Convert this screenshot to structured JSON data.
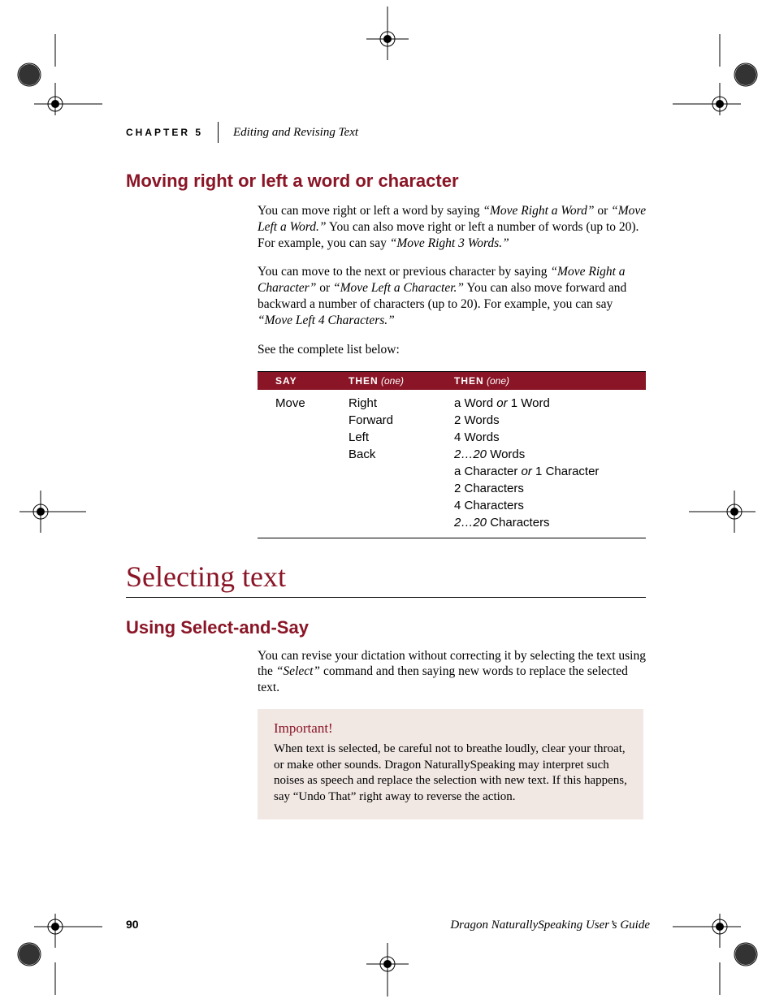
{
  "header": {
    "chapter_label": "CHAPTER 5",
    "chapter_title": "Editing and Revising Text"
  },
  "section1": {
    "heading": "Moving right or left a word or character",
    "para1_a": "You can move right or left a word by saying ",
    "para1_q1": "“Move Right a Word”",
    "para1_b": " or ",
    "para1_q2": "“Move Left a Word.”",
    "para1_c": " You can also move right or left a number of words (up to 20). For example, you can say ",
    "para1_q3": "“Move Right 3 Words.”",
    "para2_a": "You can move to the next or previous character by saying ",
    "para2_q1": "“Move Right a Character”",
    "para2_b": " or ",
    "para2_q2": "“Move Left a Character.”",
    "para2_c": " You can also move forward and backward a number of characters (up to 20). For example, you can say ",
    "para2_q3": "“Move Left 4 Characters.”",
    "para3": "See the complete list below:"
  },
  "table": {
    "head": {
      "say": "SAY",
      "then_label": "THEN",
      "then_note": "(one)"
    },
    "rows": [
      {
        "say": "Move",
        "then1": "Right",
        "then2_a": "a Word ",
        "then2_or": "or",
        "then2_b": " 1 Word"
      },
      {
        "say": "",
        "then1": "Forward",
        "then2_a": "2 Words",
        "then2_or": "",
        "then2_b": ""
      },
      {
        "say": "",
        "then1": "Left",
        "then2_a": "4 Words",
        "then2_or": "",
        "then2_b": ""
      },
      {
        "say": "",
        "then1": "Back",
        "then2_a": "",
        "then2_ital": "2…20",
        "then2_b": " Words"
      },
      {
        "say": "",
        "then1": "",
        "then2_a": "a Character ",
        "then2_or": "or",
        "then2_b": " 1 Character"
      },
      {
        "say": "",
        "then1": "",
        "then2_a": "2 Characters",
        "then2_or": "",
        "then2_b": ""
      },
      {
        "say": "",
        "then1": "",
        "then2_a": "4 Characters",
        "then2_or": "",
        "then2_b": ""
      },
      {
        "say": "",
        "then1": "",
        "then2_a": "",
        "then2_ital": "2…20",
        "then2_b": " Characters"
      }
    ]
  },
  "section2": {
    "title": "Selecting text",
    "subhead": "Using Select-and-Say",
    "para_a": "You can revise your dictation without correcting it by selecting the text using the ",
    "para_q": "“Select”",
    "para_b": " command and then saying new words to replace the selected text."
  },
  "important": {
    "title": "Important!",
    "body_a": "When text is selected, be careful not to breathe loudly, clear your throat, or make other sounds. Dragon NaturallySpeaking may interpret such noises as speech and replace the selection with new text. If this happens, say ",
    "body_q": "“Undo That”",
    "body_b": " right away to reverse the action."
  },
  "footer": {
    "page_number": "90",
    "guide": "Dragon NaturallySpeaking User’s Guide"
  }
}
